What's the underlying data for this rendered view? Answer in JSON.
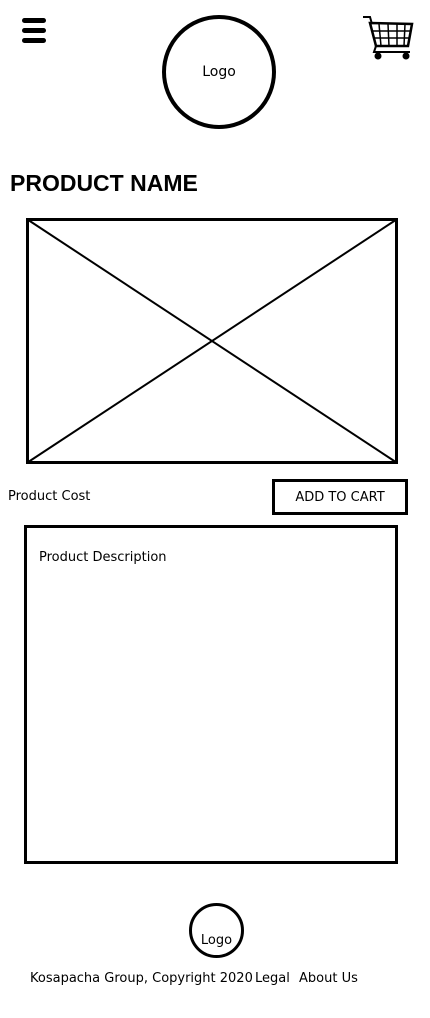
{
  "header": {
    "menu_icon": "hamburger-icon",
    "logo_text": "Logo",
    "cart_icon": "shopping-cart-icon"
  },
  "product": {
    "name": "PRODUCT NAME",
    "image_icon": "image-placeholder-icon",
    "cost_label": "Product Cost",
    "add_to_cart_label": "ADD TO CART",
    "description": "Product Description"
  },
  "footer": {
    "logo_text": "Logo",
    "copyright": "Kosapacha Group, Copyright 2020",
    "legal_link": "Legal",
    "about_link": "About Us"
  }
}
